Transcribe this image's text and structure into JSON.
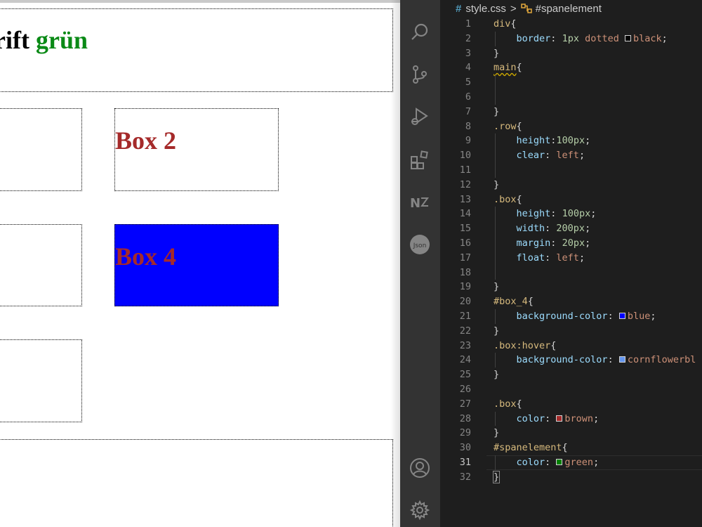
{
  "preview": {
    "heading_text": "rift ",
    "heading_green": "grün",
    "boxes": [
      "Box 2",
      "Box 4"
    ]
  },
  "editor": {
    "breadcrumb": {
      "hash": "#",
      "file": "style.css",
      "separator": ">",
      "symbol": "#spanelement"
    }
  },
  "activity_icons": [
    "search-icon",
    "source-control-icon",
    "run-debug-icon",
    "extensions-icon",
    "n2-extension-icon",
    "json-icon",
    "account-icon",
    "settings-gear-icon"
  ],
  "colors": {
    "editor_bg": "#1e1e1e",
    "activity_bg": "#333333",
    "box_text": "#a52a2a",
    "heading_green": "#0a8a16",
    "box4_bg": "#0000ff"
  },
  "code_lines": [
    {
      "n": "1",
      "tokens": [
        [
          "div",
          "sel"
        ],
        [
          "{",
          "pun"
        ]
      ]
    },
    {
      "n": "2",
      "tokens": [
        [
          "    ",
          "pun"
        ],
        [
          "border",
          "prop"
        ],
        [
          ": ",
          "pun"
        ],
        [
          "1px",
          "num"
        ],
        [
          " dotted ",
          "val"
        ],
        [
          "#000000",
          "swatch"
        ],
        [
          "black",
          "val"
        ],
        [
          ";",
          "pun"
        ]
      ]
    },
    {
      "n": "3",
      "tokens": [
        [
          "}",
          "pun"
        ]
      ]
    },
    {
      "n": "4",
      "tokens": [
        [
          "main",
          "sel squig"
        ],
        [
          "{",
          "pun"
        ]
      ]
    },
    {
      "n": "5",
      "tokens": []
    },
    {
      "n": "6",
      "tokens": []
    },
    {
      "n": "7",
      "tokens": [
        [
          "}",
          "pun"
        ]
      ]
    },
    {
      "n": "8",
      "tokens": [
        [
          ".row",
          "sel"
        ],
        [
          "{",
          "pun"
        ]
      ]
    },
    {
      "n": "9",
      "tokens": [
        [
          "    ",
          "pun"
        ],
        [
          "height",
          "prop"
        ],
        [
          ":",
          "pun"
        ],
        [
          "100px",
          "num"
        ],
        [
          ";",
          "pun"
        ]
      ]
    },
    {
      "n": "10",
      "tokens": [
        [
          "    ",
          "pun"
        ],
        [
          "clear",
          "prop"
        ],
        [
          ": ",
          "pun"
        ],
        [
          "left",
          "val"
        ],
        [
          ";",
          "pun"
        ]
      ]
    },
    {
      "n": "11",
      "tokens": []
    },
    {
      "n": "12",
      "tokens": [
        [
          "}",
          "pun"
        ]
      ]
    },
    {
      "n": "13",
      "tokens": [
        [
          ".box",
          "sel"
        ],
        [
          "{",
          "pun"
        ]
      ]
    },
    {
      "n": "14",
      "tokens": [
        [
          "    ",
          "pun"
        ],
        [
          "height",
          "prop"
        ],
        [
          ": ",
          "pun"
        ],
        [
          "100px",
          "num"
        ],
        [
          ";",
          "pun"
        ]
      ]
    },
    {
      "n": "15",
      "tokens": [
        [
          "    ",
          "pun"
        ],
        [
          "width",
          "prop"
        ],
        [
          ": ",
          "pun"
        ],
        [
          "200px",
          "num"
        ],
        [
          ";",
          "pun"
        ]
      ]
    },
    {
      "n": "16",
      "tokens": [
        [
          "    ",
          "pun"
        ],
        [
          "margin",
          "prop"
        ],
        [
          ": ",
          "pun"
        ],
        [
          "20px",
          "num"
        ],
        [
          ";",
          "pun"
        ]
      ]
    },
    {
      "n": "17",
      "tokens": [
        [
          "    ",
          "pun"
        ],
        [
          "float",
          "prop"
        ],
        [
          ": ",
          "pun"
        ],
        [
          "left",
          "val"
        ],
        [
          ";",
          "pun"
        ]
      ]
    },
    {
      "n": "18",
      "tokens": []
    },
    {
      "n": "19",
      "tokens": [
        [
          "}",
          "pun"
        ]
      ]
    },
    {
      "n": "20",
      "tokens": [
        [
          "#box_4",
          "sel"
        ],
        [
          "{",
          "pun"
        ]
      ]
    },
    {
      "n": "21",
      "tokens": [
        [
          "    ",
          "pun"
        ],
        [
          "background-color",
          "prop"
        ],
        [
          ": ",
          "pun"
        ],
        [
          "#0000ff",
          "swatch"
        ],
        [
          "blue",
          "val"
        ],
        [
          ";",
          "pun"
        ]
      ]
    },
    {
      "n": "22",
      "tokens": [
        [
          "}",
          "pun"
        ]
      ]
    },
    {
      "n": "23",
      "tokens": [
        [
          ".box:hover",
          "sel"
        ],
        [
          "{",
          "pun"
        ]
      ]
    },
    {
      "n": "24",
      "tokens": [
        [
          "    ",
          "pun"
        ],
        [
          "background-color",
          "prop"
        ],
        [
          ": ",
          "pun"
        ],
        [
          "#6495ed",
          "swatch"
        ],
        [
          "cornflowerbl",
          "val"
        ]
      ]
    },
    {
      "n": "25",
      "tokens": [
        [
          "}",
          "pun"
        ]
      ]
    },
    {
      "n": "26",
      "tokens": []
    },
    {
      "n": "27",
      "tokens": [
        [
          ".box",
          "sel"
        ],
        [
          "{",
          "pun"
        ]
      ]
    },
    {
      "n": "28",
      "tokens": [
        [
          "    ",
          "pun"
        ],
        [
          "color",
          "prop"
        ],
        [
          ": ",
          "pun"
        ],
        [
          "#a52a2a",
          "swatch"
        ],
        [
          "brown",
          "val"
        ],
        [
          ";",
          "pun"
        ]
      ]
    },
    {
      "n": "29",
      "tokens": [
        [
          "}",
          "pun"
        ]
      ]
    },
    {
      "n": "30",
      "tokens": [
        [
          "#spanelement",
          "sel"
        ],
        [
          "{",
          "pun"
        ]
      ]
    },
    {
      "n": "31",
      "tokens": [
        [
          "    ",
          "pun"
        ],
        [
          "color",
          "prop"
        ],
        [
          ": ",
          "pun"
        ],
        [
          "#008000",
          "swatch"
        ],
        [
          "green",
          "val"
        ],
        [
          ";",
          "pun"
        ]
      ]
    },
    {
      "n": "32",
      "tokens": [
        [
          "}",
          "pun"
        ]
      ]
    }
  ]
}
